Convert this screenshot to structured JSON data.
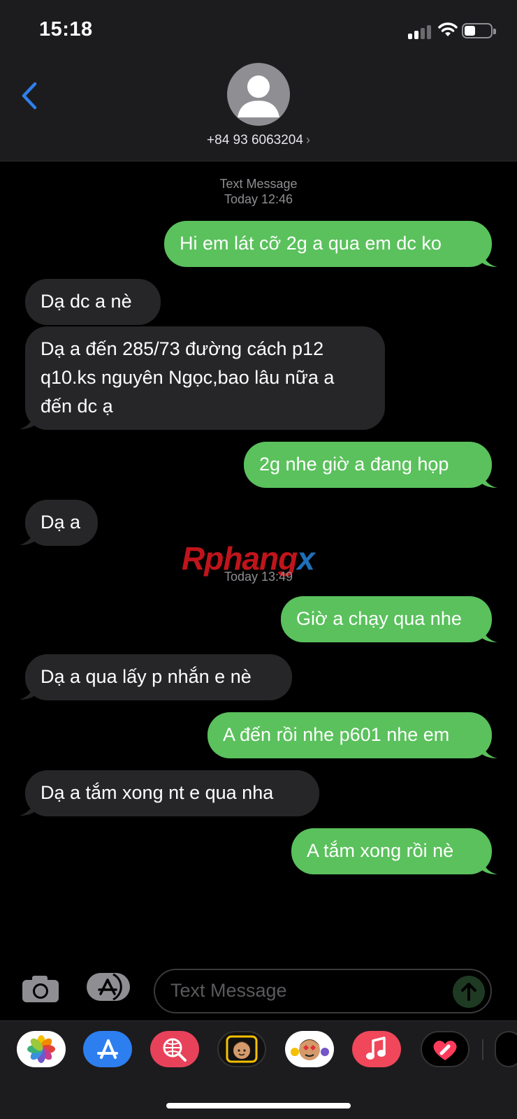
{
  "status_bar": {
    "time": "15:18"
  },
  "header": {
    "contact": "+84 93 6063204",
    "chevron": "›"
  },
  "thread": {
    "header_label": "Text Message",
    "first_timestamp": "Today 12:46",
    "second_timestamp": "Today 13:49",
    "messages": [
      {
        "direction": "sent",
        "text": "Hi em lát cỡ 2g a qua em dc ko"
      },
      {
        "direction": "received",
        "text": "Dạ dc a nè"
      },
      {
        "direction": "received",
        "text": "Dạ a đến 285/73 đường cách p12\nq10.ks nguyên Ngọc,bao lâu nữa a\nđến dc ạ"
      },
      {
        "direction": "sent",
        "text": "2g nhe giờ a đang họp"
      },
      {
        "direction": "received",
        "text": "Dạ a"
      },
      {
        "direction": "sent",
        "text": "Giờ a chạy qua nhe"
      },
      {
        "direction": "received",
        "text": "Dạ a qua lấy p nhắn e nè"
      },
      {
        "direction": "sent",
        "text": "A đến rồi nhe p601 nhe em"
      },
      {
        "direction": "received",
        "text": "Dạ a tắm xong nt e qua nha"
      },
      {
        "direction": "sent",
        "text": "A tắm xong rồi nè"
      }
    ]
  },
  "watermark": {
    "part1": "Rphang",
    "part2": "x"
  },
  "composer": {
    "placeholder": "Text Message"
  },
  "app_strip": [
    "photos-icon",
    "app-store-icon",
    "web-search-icon",
    "memoji-icon",
    "memoji-stickers-icon",
    "music-icon",
    "digital-touch-icon"
  ],
  "colors": {
    "sent_bubble": "#5ac15c",
    "received_bubble": "#262628",
    "accent": "#2f80ed"
  }
}
